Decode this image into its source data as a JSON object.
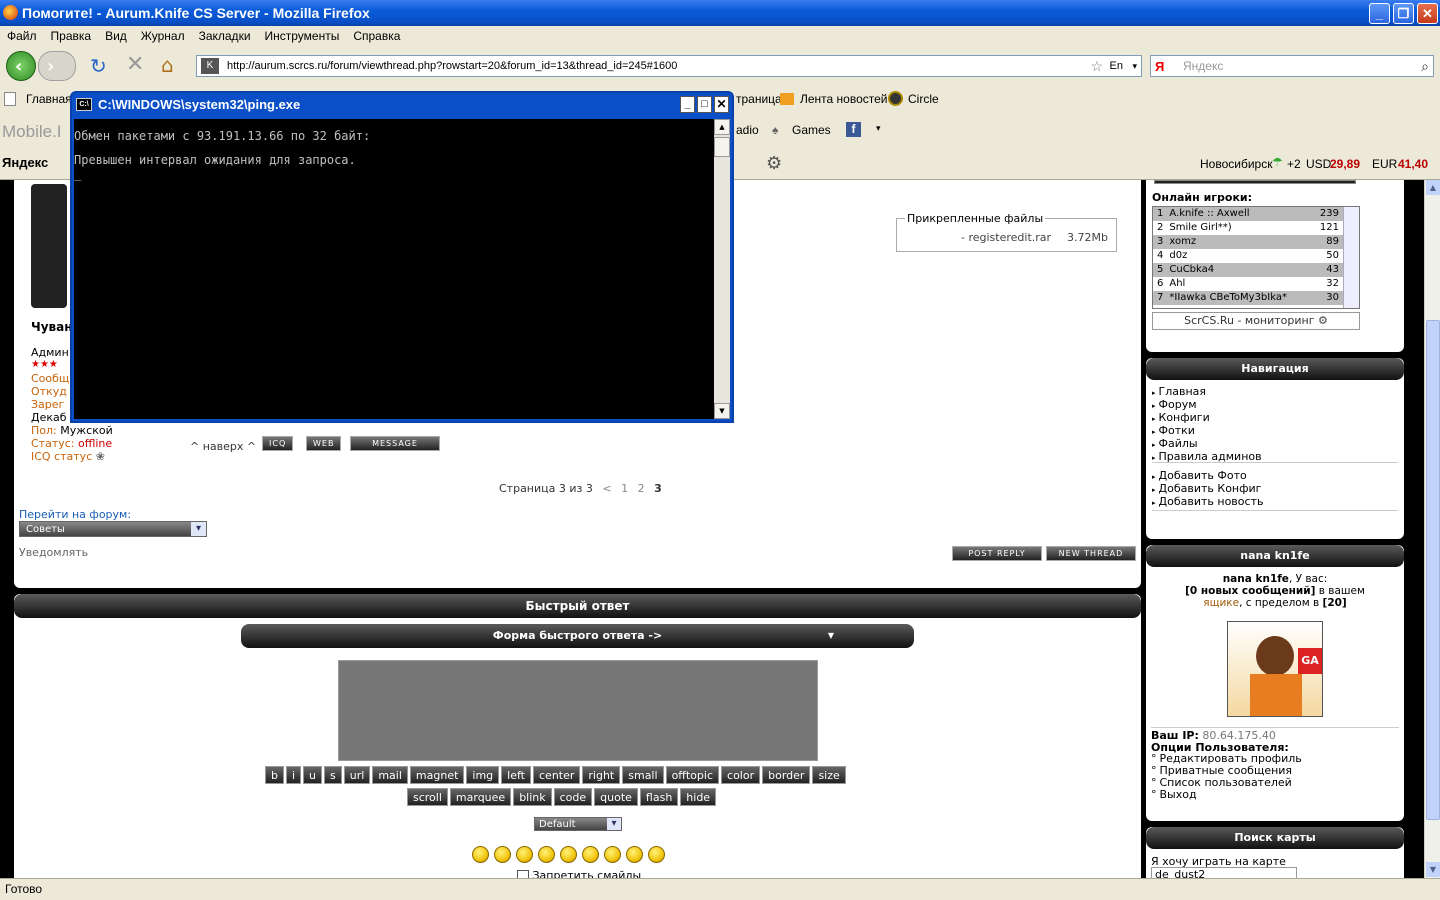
{
  "window": {
    "title": "Помогите! - Aurum.Knife CS Server - Mozilla Firefox"
  },
  "menu": [
    "Файл",
    "Правка",
    "Вид",
    "Журнал",
    "Закладки",
    "Инструменты",
    "Справка"
  ],
  "nav": {
    "url": "http://aurum.scrcs.ru/forum/viewthread.php?rowstart=20&forum_id=13&thread_id=245#1600",
    "search_placeholder": "Яндекс",
    "lang": "En"
  },
  "bookmarks": {
    "home": "Главная",
    "page": "траница",
    "news": "Лента новостей",
    "circle": "Circle"
  },
  "toolbar2": {
    "mobile": "Mobile.I",
    "radio": "adio",
    "games": "Games"
  },
  "toolbar3": {
    "yandex": "Яндекс",
    "city": "Новосибирск",
    "temp": "+2",
    "usd_label": "USD",
    "usd": "29,89",
    "eur_label": "EUR",
    "eur": "41,40"
  },
  "cmd": {
    "title": "C:\\WINDOWS\\system32\\ping.exe",
    "line1": "Обмен пакетами с 93.191.13.66 по 32 байт:",
    "line2": "Превышен интервал ожидания для запроса.",
    "cursor": "_"
  },
  "profile": {
    "name": "Чуван",
    "role": "Админ",
    "msgs": "Сообщ",
    "from": "Откуд",
    "reg": "Зарег",
    "reg_date": "Декаб",
    "gender_label": "Пол:",
    "gender": "Мужской",
    "status_label": "Статус:",
    "status": "offline",
    "icq_label": "ICQ статус"
  },
  "attach": {
    "legend": "Прикрепленные файлы",
    "file": "- registeredit.rar",
    "size": "3.72Mb"
  },
  "post_links": {
    "top": "^ наверх ^",
    "icq": "ICQ",
    "web": "WEB",
    "message": "MESSAGE"
  },
  "pager": {
    "label": "Страница 3 из 3",
    "prev": "<",
    "p1": "1",
    "p2": "2",
    "p3": "3"
  },
  "jump": {
    "label": "Перейти на форум:",
    "selected": "Советы"
  },
  "notify": "Уведомлять",
  "buttons": {
    "post_reply": "POST REPLY",
    "new_thread": "NEW THREAD"
  },
  "quick": {
    "title": "Быстрый ответ",
    "form": "Форма быстрого ответа ->",
    "arrow": "▼",
    "select": "Default",
    "disable_smileys": "Запретить смайлы"
  },
  "bbcode_row1": [
    "b",
    "i",
    "u",
    "s",
    "url",
    "mail",
    "magnet",
    "img",
    "left",
    "center",
    "right",
    "small",
    "offtopic",
    "color",
    "border",
    "size"
  ],
  "bbcode_row2": [
    "scroll",
    "marquee",
    "blink",
    "code",
    "quote",
    "flash",
    "hide"
  ],
  "online": {
    "title": "Онлайн игроки:",
    "players": [
      {
        "n": "1",
        "name": "A.knife :: Axwell",
        "score": "239"
      },
      {
        "n": "2",
        "name": "Smile Girl**)",
        "score": "121"
      },
      {
        "n": "3",
        "name": "xomz",
        "score": "89"
      },
      {
        "n": "4",
        "name": "d0z",
        "score": "50"
      },
      {
        "n": "5",
        "name": "CuCbka4",
        "score": "43"
      },
      {
        "n": "6",
        "name": "Ahl",
        "score": "32"
      },
      {
        "n": "7",
        "name": "*IIawka CBeToMy3bIka*",
        "score": "30"
      }
    ],
    "footer": "ScrCS.Ru - мониторинг"
  },
  "navigation": {
    "title": "Навигация",
    "items": [
      "Главная",
      "Форум",
      "Конфиги",
      "Фотки",
      "Файлы",
      "Правила админов"
    ],
    "items2": [
      "Добавить Фото",
      "Добавить Конфиг",
      "Добавить новость"
    ]
  },
  "user": {
    "title": "nana kn1fe",
    "name": "nana kn1fe",
    "greeting": ", У вас:",
    "new_msgs": "[0 новых сообщений]",
    "in_box": " в вашем",
    "box": "ящике",
    "limit": ", с пределом в",
    "limit_val": "[20]",
    "ip_label": "Ваш IP:",
    "ip": "80.64.175.40",
    "options_label": "Опции Пользователя:",
    "options": [
      "Редактировать профиль",
      "Приватные сообщения",
      "Список пользователей",
      "Выход"
    ]
  },
  "mapsearch": {
    "title": "Поиск карты",
    "label": "Я хочу играть на карте",
    "value": "de_dust2"
  },
  "status": "Готово",
  "colors": {
    "accent": "#0a5bd9",
    "orange": "#c8640a"
  }
}
